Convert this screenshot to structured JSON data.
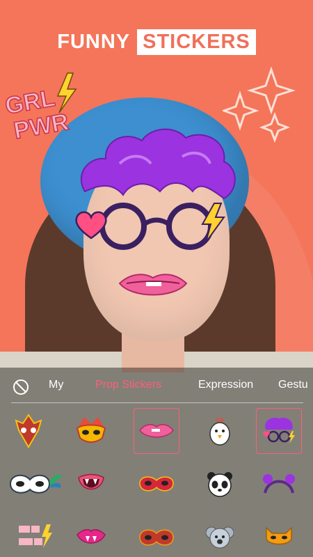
{
  "header": {
    "title_part1": "FUNNY",
    "title_part2": "STICKERS"
  },
  "overlay_text": {
    "grl_line1": "GRL",
    "grl_line2": "PWR"
  },
  "tabs": [
    {
      "label": "My"
    },
    {
      "label": "Prop Stickers",
      "active": true
    },
    {
      "label": "Expression"
    },
    {
      "label": "Gestu"
    }
  ],
  "stickers_row1": [
    "mask-icon",
    "crown-mask-icon",
    "lips-icon",
    "chicken-icon",
    "wig-glasses-icon"
  ],
  "stickers_row2": [
    "carnival-mask-icon",
    "vampire-mouth-icon",
    "red-mask-icon",
    "panda-icon",
    "headband-icon"
  ],
  "stickers_row3": [
    "grl-pwr-icon",
    "fangs-lips-icon",
    "red-eye-mask-icon",
    "koala-icon",
    "fox-mask-icon"
  ],
  "colors": {
    "accent": "#ff5f78",
    "background": "#f47559"
  }
}
